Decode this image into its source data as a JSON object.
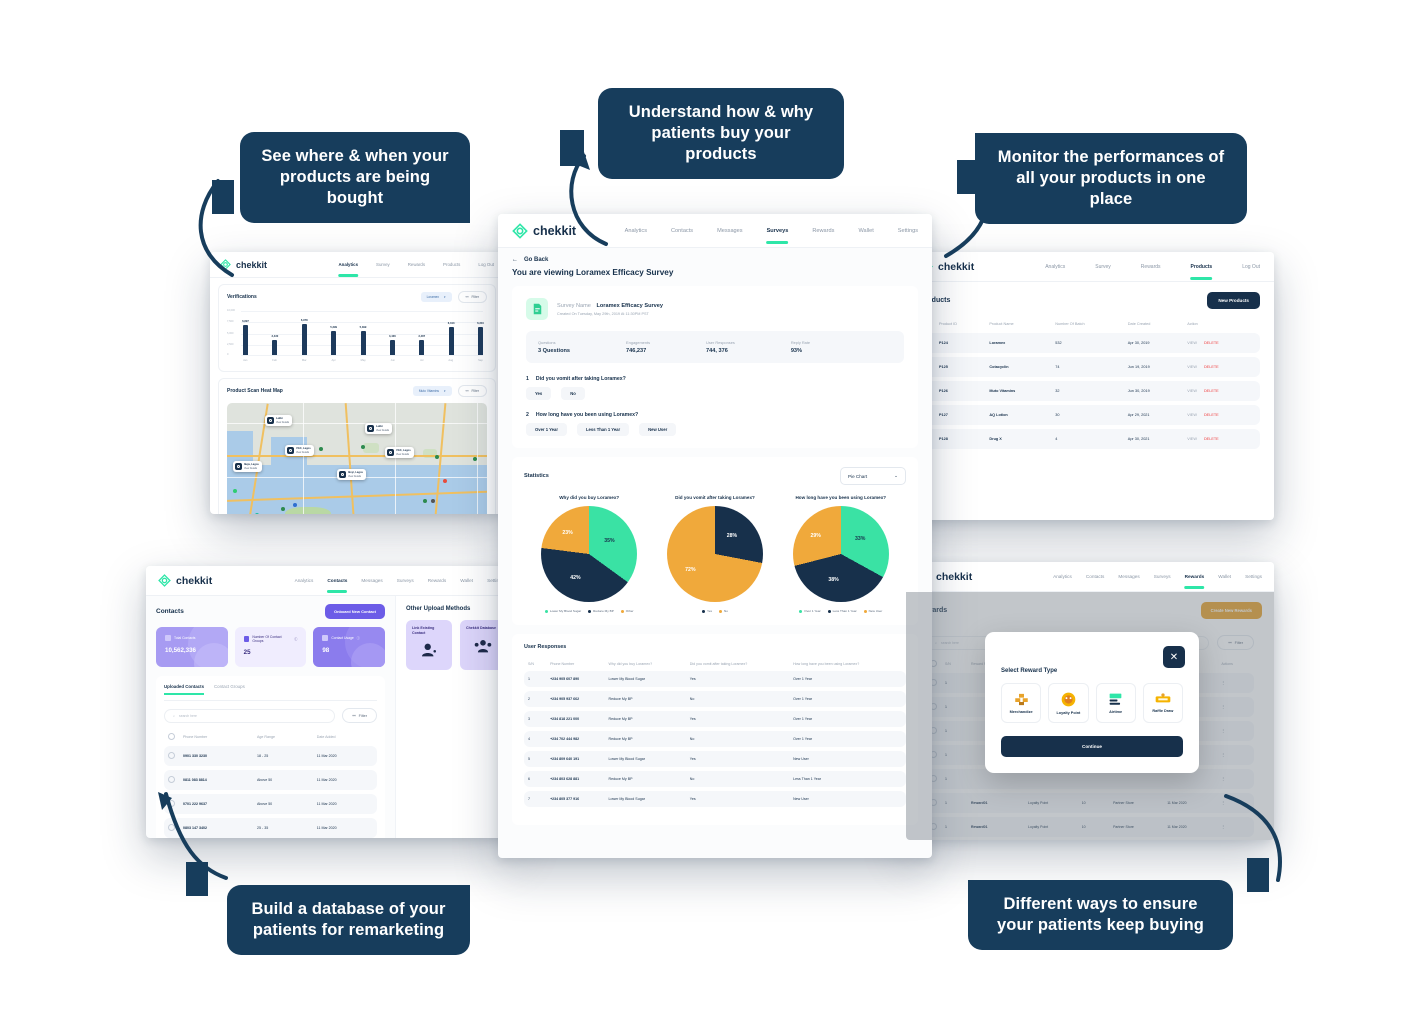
{
  "callouts": {
    "where": "See where & when your products are being bought",
    "understand": "Understand how & why patients buy your products",
    "monitor": "Monitor the performances of all your products in one place",
    "build": "Build a database of your patients for remarketing",
    "different": "Different ways to ensure your patients keep buying"
  },
  "brand": {
    "name": "chekkit"
  },
  "analytics": {
    "nav": [
      "Analytics",
      "Survey",
      "Rewards",
      "Products",
      "Log Out"
    ],
    "active_nav": "Analytics",
    "verifications": {
      "title": "Verifications",
      "filter_select": "Loramex",
      "filter_button": "Filter",
      "y_ticks": [
        "10,000",
        "7,500",
        "5,000",
        "2,500",
        "0"
      ]
    },
    "heatmap": {
      "title": "Product Scan Heat Map",
      "filter_select": "Muto Vitamins",
      "filter_button": "Filter",
      "pins": [
        {
          "title": "Lekki",
          "sub": "View Details"
        },
        {
          "title": "VGC, Lagos",
          "sub": "View Details"
        },
        {
          "title": "Ikeja, Lagos",
          "sub": "View Details"
        },
        {
          "title": "Ikoyi, Lagos",
          "sub": "View Details"
        },
        {
          "title": "Lekki",
          "sub": "View Details"
        },
        {
          "title": "VGC, Lagos",
          "sub": "View Details"
        }
      ]
    }
  },
  "survey": {
    "nav": [
      "Analytics",
      "Contacts",
      "Messages",
      "Surveys",
      "Rewards",
      "Wallet",
      "Settings"
    ],
    "active_nav": "Surveys",
    "go_back": "Go Back",
    "viewing": "You are viewing Loramex Efficacy Survey",
    "name_label": "Survey Name",
    "name_value": "Loramex Efficacy Survey",
    "created": "Created On Tuesday, May 29th, 2019 At 11:30PM PST",
    "stats": [
      {
        "key": "Questions",
        "value": "3 Questions"
      },
      {
        "key": "Engagements",
        "value": "746,237"
      },
      {
        "key": "User Responses",
        "value": "744, 376"
      },
      {
        "key": "Reply Rate",
        "value": "93%"
      }
    ],
    "questions": [
      {
        "n": "1",
        "text": "Did you vomit after taking Loramex?",
        "answers": [
          "Yes",
          "No"
        ]
      },
      {
        "n": "2",
        "text": "How long have you been using Loramex?",
        "answers": [
          "Over 1 Year",
          "Less Than 1 Year",
          "New User"
        ]
      }
    ],
    "statistics_title": "Statistics",
    "chart_select": "Pie Chart",
    "responses_title": "User Responses",
    "response_columns": [
      "S/N",
      "Phone Number",
      "Why did you buy Loramex?",
      "Did you vomit after taking Loramex?",
      "How long have you been using Loramex?"
    ],
    "responses": [
      [
        "1",
        "+234 905 607 890",
        "Lower My Blood Sugar",
        "Yes",
        "Over 1 Year"
      ],
      [
        "2",
        "+234 905 937 662",
        "Reduce My BP",
        "No",
        "Over 1 Year"
      ],
      [
        "3",
        "+234 818 221 000",
        "Reduce My BP",
        "Yes",
        "Over 1 Year"
      ],
      [
        "4",
        "+234 702 444 982",
        "Reduce My BP",
        "No",
        "Over 1 Year"
      ],
      [
        "5",
        "+234 809 640 191",
        "Lower My Blood Sugar",
        "Yes",
        "New User"
      ],
      [
        "6",
        "+234 803 628 881",
        "Reduce My BP",
        "No",
        "Less Than 1 Year"
      ],
      [
        "7",
        "+234 805 377 916",
        "Lower My Blood Sugar",
        "Yes",
        "New User"
      ]
    ]
  },
  "products": {
    "nav": [
      "Analytics",
      "Survey",
      "Rewards",
      "Products",
      "Log Out"
    ],
    "active_nav": "Products",
    "title": "Products",
    "new_button": "New Products",
    "columns": [
      "Product ID",
      "Product Name",
      "Number Of Batch",
      "Date Created",
      "Action"
    ],
    "rows": [
      {
        "id": "P124",
        "name": "Loramex",
        "batch": "532",
        "date": "Apr 30, 2019",
        "view": "VIEW",
        "delete": "DELETE"
      },
      {
        "id": "P125",
        "name": "Cotacyclin",
        "batch": "74",
        "date": "Jun 19, 2019",
        "view": "VIEW",
        "delete": "DELETE"
      },
      {
        "id": "P126",
        "name": "Muto Vitamins",
        "batch": "32",
        "date": "Jun 30, 2019",
        "view": "VIEW",
        "delete": "DELETE"
      },
      {
        "id": "P127",
        "name": "AQ Lotion",
        "batch": "30",
        "date": "Apr 29, 2021",
        "view": "VIEW",
        "delete": "DELETE"
      },
      {
        "id": "P128",
        "name": "Drug X",
        "batch": "4",
        "date": "Apr 30, 2021",
        "view": "VIEW",
        "delete": "DELETE"
      }
    ]
  },
  "contacts": {
    "nav": [
      "Analytics",
      "Contacts",
      "Messages",
      "Surveys",
      "Rewards",
      "Wallet",
      "Settings"
    ],
    "active_nav": "Contacts",
    "title": "Contacts",
    "onboard_button": "Onboard New Contact",
    "cards": [
      {
        "label": "Total Contacts",
        "value": "10,562,336"
      },
      {
        "label": "Number Of Contact Groups",
        "value": "25"
      },
      {
        "label": "Contact Usage",
        "value": "98"
      }
    ],
    "other_title": "Other Upload Methods",
    "methods": [
      {
        "label": "Link Existing Contact",
        "icon": "person-icon"
      },
      {
        "label": "Chekkit Database",
        "icon": "group-icon"
      }
    ],
    "tabs": [
      "Uploaded Contacts",
      "Contact Groups"
    ],
    "active_tab": "Uploaded Contacts",
    "search_placeholder": "search here",
    "filter_button": "Filter",
    "columns": [
      "Phone Number",
      "Age Range",
      "Date Added"
    ],
    "rows": [
      [
        "0901 330 3230",
        "18 - 25",
        "11 Mar 2020"
      ],
      [
        "0811 083 8814",
        "Above 50",
        "11 Mar 2020"
      ],
      [
        "0701 222 9637",
        "Above 50",
        "11 Mar 2020"
      ],
      [
        "0803 147 3402",
        "25 - 35",
        "11 Mar 2020"
      ]
    ]
  },
  "rewards": {
    "nav": [
      "Analytics",
      "Contacts",
      "Messages",
      "Surveys",
      "Rewards",
      "Wallet",
      "Settings"
    ],
    "active_nav": "Rewards",
    "title": "Rewards",
    "create_button": "Create New Rewards",
    "search_placeholder": "search here",
    "filter_button": "Filter",
    "columns": [
      "S/N",
      "Reward Name",
      "Reward Type",
      "Value",
      "Partner",
      "Date Created",
      "Actions"
    ],
    "rows": [
      [
        "1",
        "",
        "",
        "",
        "",
        "",
        ""
      ],
      [
        "1",
        "",
        "",
        "",
        "",
        "",
        ""
      ],
      [
        "1",
        "",
        "",
        "",
        "",
        "",
        ""
      ],
      [
        "1",
        "",
        "",
        "",
        "",
        "",
        ""
      ],
      [
        "1",
        "",
        "",
        "",
        "",
        "",
        ""
      ],
      [
        "1",
        "Reward01",
        "Loyalty Point",
        "10",
        "Partner Store",
        "11 Mar 2020",
        ""
      ],
      [
        "1",
        "Reward01",
        "Loyalty Point",
        "10",
        "Partner Store",
        "11 Mar 2020",
        ""
      ]
    ],
    "modal": {
      "title": "Select Reward Type",
      "close": "✕",
      "types": [
        {
          "label": "Merchandize",
          "icon": "boxes-icon"
        },
        {
          "label": "Loyalty Point",
          "icon": "coin-icon"
        },
        {
          "label": "Airtime",
          "icon": "phone-card-icon"
        },
        {
          "label": "Raffle Draw",
          "icon": "ticket-icon"
        }
      ],
      "continue": "Continue"
    }
  },
  "chart_data": [
    {
      "type": "bar",
      "title": "Verifications",
      "categories": [
        "Jan",
        "Feb",
        "Mar",
        "Apr",
        "May",
        "Jun",
        "Jul",
        "Aug",
        "Sep"
      ],
      "values": [
        6897,
        3430,
        6978,
        5399,
        5399,
        3436,
        3487,
        6313,
        6310
      ],
      "value_labels": [
        "6,897",
        "3,430",
        "6,978",
        "5,399",
        "5,399",
        "3,436",
        "3,487",
        "6,313",
        "6,310"
      ],
      "ylabel": "",
      "xlabel": "",
      "ylim": [
        0,
        10000
      ],
      "grid": true
    },
    {
      "type": "pie",
      "title": "Why did you buy Loramex?",
      "labels": [
        "Lower My Blood Sugar",
        "Reduce My BP",
        "Other"
      ],
      "values": [
        35,
        42,
        23
      ],
      "value_labels": [
        "35%",
        "42%",
        "23%"
      ],
      "colors": [
        "#3ae2a4",
        "#17304b",
        "#f0a93b"
      ],
      "legend": "bottom"
    },
    {
      "type": "pie",
      "title": "Did you vomit after taking Loramex?",
      "labels": [
        "Yes",
        "No"
      ],
      "values": [
        28,
        72
      ],
      "value_labels": [
        "28%",
        "72%"
      ],
      "colors": [
        "#17304b",
        "#f0a93b"
      ],
      "legend": "bottom"
    },
    {
      "type": "pie",
      "title": "How long have you been using Loramex?",
      "labels": [
        "Over 1 Year",
        "Less Than 1 Year",
        "New User"
      ],
      "values": [
        33,
        38,
        29
      ],
      "value_labels": [
        "33%",
        "38%",
        "29%"
      ],
      "colors": [
        "#3ae2a4",
        "#17304b",
        "#f0a93b"
      ],
      "legend": "bottom"
    }
  ],
  "colors": {
    "navy": "#17304b",
    "green": "#2ee6a8",
    "amber": "#f0a93b",
    "purple": "#6c5ce7",
    "gold": "#e8a32b",
    "red": "#ef3d3d"
  }
}
